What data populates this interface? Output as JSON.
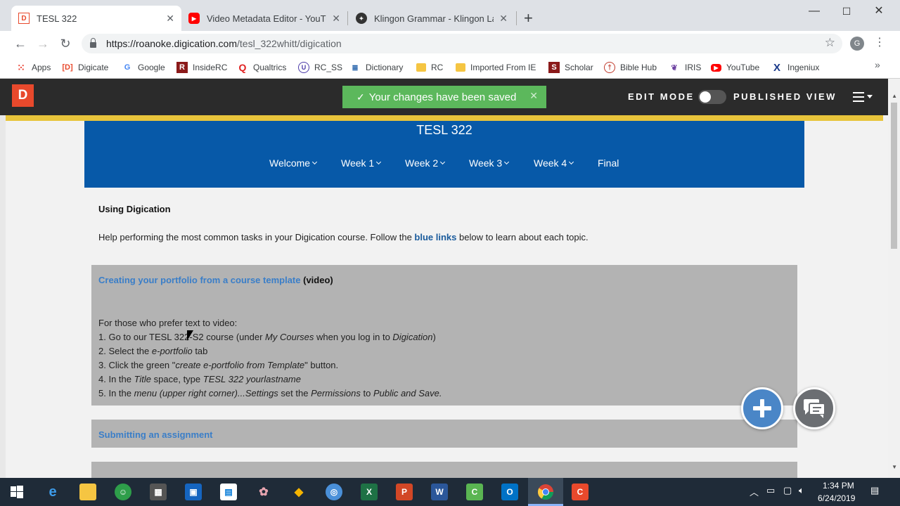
{
  "browser": {
    "tabs": [
      {
        "title": "TESL 322",
        "active": true,
        "favicon": "digication-icon"
      },
      {
        "title": "Video Metadata Editor - YouTube",
        "active": false,
        "favicon": "youtube-icon"
      },
      {
        "title": "Klingon Grammar - Klingon Lang",
        "active": false,
        "favicon": "klingon-icon"
      }
    ],
    "url_host": "https://roanoke.digication.com",
    "url_path": "/tesl_322whitt/digication",
    "profile_initial": "G",
    "bookmarks": [
      "Apps",
      "Digicate",
      "Google",
      "InsideRC",
      "Qualtrics",
      "RC_SS",
      "Dictionary",
      "RC",
      "Imported From IE",
      "Scholar",
      "Bible Hub",
      "IRIS",
      "YouTube",
      "Ingeniux"
    ]
  },
  "header": {
    "logo": "D",
    "toast": "Your changes have been saved",
    "edit_mode": "EDIT MODE",
    "published_view": "PUBLISHED VIEW"
  },
  "course": {
    "title": "TESL 322",
    "menu": [
      {
        "label": "Welcome",
        "dropdown": true
      },
      {
        "label": "Week 1",
        "dropdown": true
      },
      {
        "label": "Week 2",
        "dropdown": true
      },
      {
        "label": "Week 3",
        "dropdown": true
      },
      {
        "label": "Week 4",
        "dropdown": true
      },
      {
        "label": "Final",
        "dropdown": false
      }
    ]
  },
  "content": {
    "intro_title": "Using Digication",
    "intro_before": "Help performing the most common tasks in your Digication course. Follow the ",
    "intro_link": "blue links",
    "intro_after": " below to learn about each topic.",
    "sections": [
      {
        "link": "Creating your portfolio from a course template",
        "suffix": " (video)",
        "lead": "For those who prefer text to video:",
        "steps": [
          [
            "1. Go to our TESL 322-S2 course (under ",
            "My Courses",
            " when you log in to ",
            "Digication",
            ")"
          ],
          [
            "2. Select the ",
            "e-portfolio",
            " tab"
          ],
          [
            "3. Click the green \"",
            "create e-portfolio from Template",
            "\" button."
          ],
          [
            "4. In the ",
            "Title",
            " space, type ",
            "TESL 322 yourlastname"
          ],
          [
            "5. In the ",
            "menu (upper right corner)...Settings",
            " set the ",
            "Permissions",
            " to ",
            "Public and Save."
          ]
        ]
      },
      {
        "link": "Submitting an assignment",
        "suffix": ""
      }
    ]
  },
  "taskbar": {
    "time": "1:34 PM",
    "date": "6/24/2019"
  },
  "colors": {
    "header_bg": "#2b2b2b",
    "toast_bg": "#5cb85c",
    "banner_bg": "#0759a8",
    "gold": "#e8c43b",
    "link": "#3a7ec8",
    "section_bg": "#b3b3b3"
  }
}
